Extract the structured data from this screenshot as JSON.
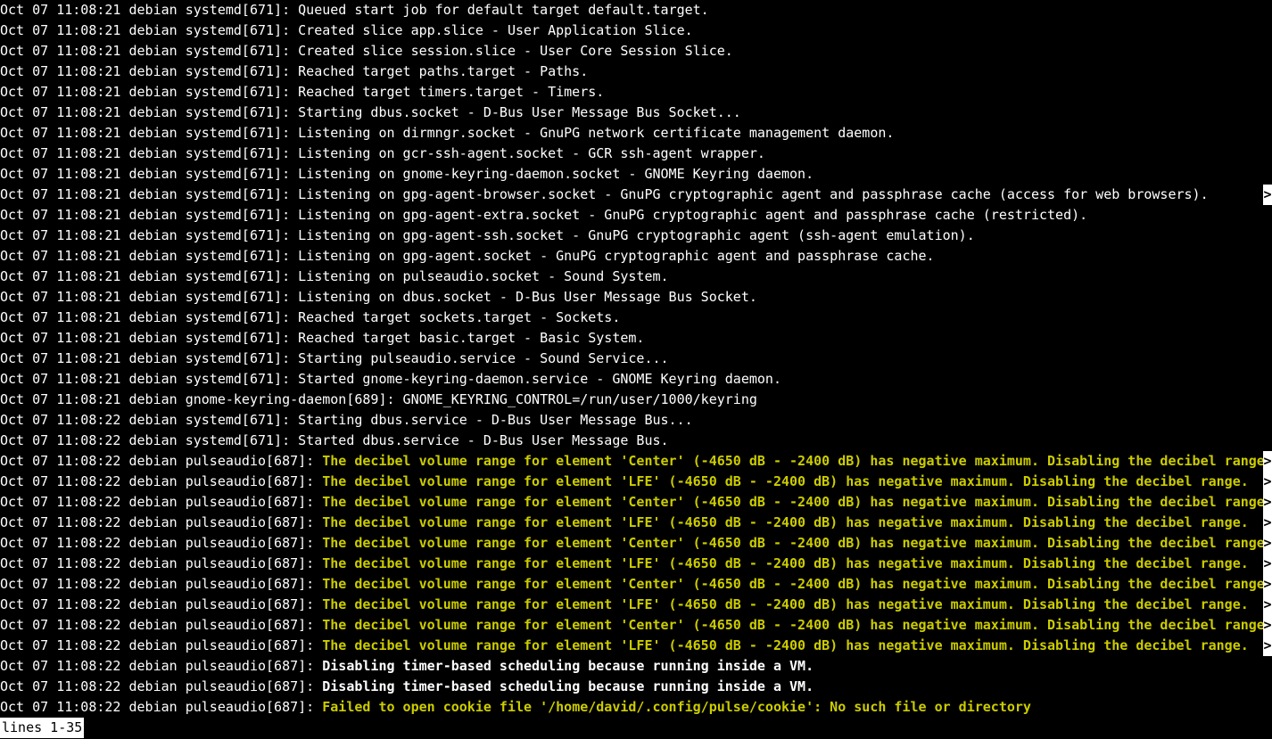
{
  "lines": [
    {
      "prefix": "Oct 07 11:08:21 debian systemd[671]: ",
      "msg": "Queued start job for default target default.target.",
      "style": "plain",
      "overflow": false
    },
    {
      "prefix": "Oct 07 11:08:21 debian systemd[671]: ",
      "msg": "Created slice app.slice - User Application Slice.",
      "style": "plain",
      "overflow": false
    },
    {
      "prefix": "Oct 07 11:08:21 debian systemd[671]: ",
      "msg": "Created slice session.slice - User Core Session Slice.",
      "style": "plain",
      "overflow": false
    },
    {
      "prefix": "Oct 07 11:08:21 debian systemd[671]: ",
      "msg": "Reached target paths.target - Paths.",
      "style": "plain",
      "overflow": false
    },
    {
      "prefix": "Oct 07 11:08:21 debian systemd[671]: ",
      "msg": "Reached target timers.target - Timers.",
      "style": "plain",
      "overflow": false
    },
    {
      "prefix": "Oct 07 11:08:21 debian systemd[671]: ",
      "msg": "Starting dbus.socket - D-Bus User Message Bus Socket...",
      "style": "plain",
      "overflow": false
    },
    {
      "prefix": "Oct 07 11:08:21 debian systemd[671]: ",
      "msg": "Listening on dirmngr.socket - GnuPG network certificate management daemon.",
      "style": "plain",
      "overflow": false
    },
    {
      "prefix": "Oct 07 11:08:21 debian systemd[671]: ",
      "msg": "Listening on gcr-ssh-agent.socket - GCR ssh-agent wrapper.",
      "style": "plain",
      "overflow": false
    },
    {
      "prefix": "Oct 07 11:08:21 debian systemd[671]: ",
      "msg": "Listening on gnome-keyring-daemon.socket - GNOME Keyring daemon.",
      "style": "plain",
      "overflow": false
    },
    {
      "prefix": "Oct 07 11:08:21 debian systemd[671]: ",
      "msg": "Listening on gpg-agent-browser.socket - GnuPG cryptographic agent and passphrase cache (access for web browsers).",
      "style": "plain",
      "overflow": true
    },
    {
      "prefix": "Oct 07 11:08:21 debian systemd[671]: ",
      "msg": "Listening on gpg-agent-extra.socket - GnuPG cryptographic agent and passphrase cache (restricted).",
      "style": "plain",
      "overflow": false
    },
    {
      "prefix": "Oct 07 11:08:21 debian systemd[671]: ",
      "msg": "Listening on gpg-agent-ssh.socket - GnuPG cryptographic agent (ssh-agent emulation).",
      "style": "plain",
      "overflow": false
    },
    {
      "prefix": "Oct 07 11:08:21 debian systemd[671]: ",
      "msg": "Listening on gpg-agent.socket - GnuPG cryptographic agent and passphrase cache.",
      "style": "plain",
      "overflow": false
    },
    {
      "prefix": "Oct 07 11:08:21 debian systemd[671]: ",
      "msg": "Listening on pulseaudio.socket - Sound System.",
      "style": "plain",
      "overflow": false
    },
    {
      "prefix": "Oct 07 11:08:21 debian systemd[671]: ",
      "msg": "Listening on dbus.socket - D-Bus User Message Bus Socket.",
      "style": "plain",
      "overflow": false
    },
    {
      "prefix": "Oct 07 11:08:21 debian systemd[671]: ",
      "msg": "Reached target sockets.target - Sockets.",
      "style": "plain",
      "overflow": false
    },
    {
      "prefix": "Oct 07 11:08:21 debian systemd[671]: ",
      "msg": "Reached target basic.target - Basic System.",
      "style": "plain",
      "overflow": false
    },
    {
      "prefix": "Oct 07 11:08:21 debian systemd[671]: ",
      "msg": "Starting pulseaudio.service - Sound Service...",
      "style": "plain",
      "overflow": false
    },
    {
      "prefix": "Oct 07 11:08:21 debian systemd[671]: ",
      "msg": "Started gnome-keyring-daemon.service - GNOME Keyring daemon.",
      "style": "plain",
      "overflow": false
    },
    {
      "prefix": "Oct 07 11:08:21 debian gnome-keyring-daemon[689]: ",
      "msg": "GNOME_KEYRING_CONTROL=/run/user/1000/keyring",
      "style": "plain",
      "overflow": false
    },
    {
      "prefix": "Oct 07 11:08:22 debian systemd[671]: ",
      "msg": "Starting dbus.service - D-Bus User Message Bus...",
      "style": "plain",
      "overflow": false
    },
    {
      "prefix": "Oct 07 11:08:22 debian systemd[671]: ",
      "msg": "Started dbus.service - D-Bus User Message Bus.",
      "style": "plain",
      "overflow": false
    },
    {
      "prefix": "Oct 07 11:08:22 debian pulseaudio[687]: ",
      "msg": "The decibel volume range for element 'Center' (-4650 dB - -2400 dB) has negative maximum. Disabling the decibel range.",
      "style": "warn",
      "overflow": true
    },
    {
      "prefix": "Oct 07 11:08:22 debian pulseaudio[687]: ",
      "msg": "The decibel volume range for element 'LFE' (-4650 dB - -2400 dB) has negative maximum. Disabling the decibel range.",
      "style": "warn",
      "overflow": true
    },
    {
      "prefix": "Oct 07 11:08:22 debian pulseaudio[687]: ",
      "msg": "The decibel volume range for element 'Center' (-4650 dB - -2400 dB) has negative maximum. Disabling the decibel range.",
      "style": "warn",
      "overflow": true
    },
    {
      "prefix": "Oct 07 11:08:22 debian pulseaudio[687]: ",
      "msg": "The decibel volume range for element 'LFE' (-4650 dB - -2400 dB) has negative maximum. Disabling the decibel range.",
      "style": "warn",
      "overflow": true
    },
    {
      "prefix": "Oct 07 11:08:22 debian pulseaudio[687]: ",
      "msg": "The decibel volume range for element 'Center' (-4650 dB - -2400 dB) has negative maximum. Disabling the decibel range.",
      "style": "warn",
      "overflow": true
    },
    {
      "prefix": "Oct 07 11:08:22 debian pulseaudio[687]: ",
      "msg": "The decibel volume range for element 'LFE' (-4650 dB - -2400 dB) has negative maximum. Disabling the decibel range.",
      "style": "warn",
      "overflow": true
    },
    {
      "prefix": "Oct 07 11:08:22 debian pulseaudio[687]: ",
      "msg": "The decibel volume range for element 'Center' (-4650 dB - -2400 dB) has negative maximum. Disabling the decibel range.",
      "style": "warn",
      "overflow": true
    },
    {
      "prefix": "Oct 07 11:08:22 debian pulseaudio[687]: ",
      "msg": "The decibel volume range for element 'LFE' (-4650 dB - -2400 dB) has negative maximum. Disabling the decibel range.",
      "style": "warn",
      "overflow": true
    },
    {
      "prefix": "Oct 07 11:08:22 debian pulseaudio[687]: ",
      "msg": "The decibel volume range for element 'Center' (-4650 dB - -2400 dB) has negative maximum. Disabling the decibel range.",
      "style": "warn",
      "overflow": true
    },
    {
      "prefix": "Oct 07 11:08:22 debian pulseaudio[687]: ",
      "msg": "The decibel volume range for element 'LFE' (-4650 dB - -2400 dB) has negative maximum. Disabling the decibel range.",
      "style": "warn",
      "overflow": true
    },
    {
      "prefix": "Oct 07 11:08:22 debian pulseaudio[687]: ",
      "msg": "Disabling timer-based scheduling because running inside a VM.",
      "style": "bold",
      "overflow": false
    },
    {
      "prefix": "Oct 07 11:08:22 debian pulseaudio[687]: ",
      "msg": "Disabling timer-based scheduling because running inside a VM.",
      "style": "bold",
      "overflow": false
    },
    {
      "prefix": "Oct 07 11:08:22 debian pulseaudio[687]: ",
      "msg": "Failed to open cookie file '/home/david/.config/pulse/cookie': No such file or directory",
      "style": "warn",
      "overflow": false
    }
  ],
  "status": "lines 1-35",
  "overflow_glyph": ">"
}
